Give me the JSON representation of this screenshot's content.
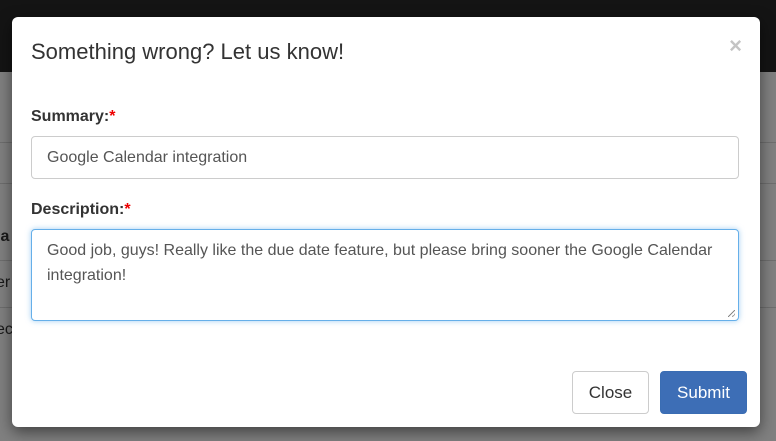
{
  "background": {
    "fragments": [
      "la",
      "er",
      "ec"
    ]
  },
  "modal": {
    "title": "Something wrong? Let us know!",
    "close_icon": "×",
    "summary_label": "Summary:",
    "description_label": "Description:",
    "required_mark": "*",
    "summary_value": "Google Calendar integration",
    "description_value": "Good job, guys! Really like the due date feature, but please bring sooner the Google Calendar integration!",
    "close_button": "Close",
    "submit_button": "Submit"
  },
  "colors": {
    "primary": "#3d6eb6",
    "required": "#ee0000"
  }
}
